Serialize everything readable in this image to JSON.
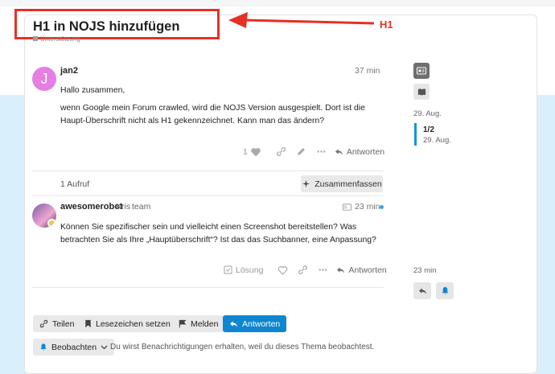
{
  "topic": {
    "title": "H1 in NOJS hinzufügen",
    "category": "Unterstützung"
  },
  "annotation": {
    "label": "H1"
  },
  "posts": [
    {
      "avatar_letter": "J",
      "username": "jan2",
      "time": "37 min",
      "paragraphs": [
        "Hallo zusammen,",
        "wenn Google mein Forum crawled, wird die NOJS Version ausgespielt. Dort ist die Haupt-Überschrift nicht als H1 gekennzeichnet. Kann man das ändern?"
      ],
      "like_count": "1",
      "reply_label": "Antworten"
    },
    {
      "username": "awesomerobot",
      "full_name": "Kris",
      "group": "team",
      "time": "23 min",
      "paragraphs": [
        "Können Sie spezifischer sein und vielleicht einen Screenshot bereitstellen? Was betrachten Sie als Ihre „Hauptüberschrift“? Ist das das Suchbanner, eine Anpassung?"
      ],
      "solution_label": "Lösung",
      "reply_label": "Antworten"
    }
  ],
  "views": {
    "label": "1 Aufruf"
  },
  "summarize_button": "Zusammenfassen",
  "timeline": {
    "start_date": "29. Aug.",
    "position": "1/2",
    "position_date": "29. Aug.",
    "end_date": "23 min"
  },
  "footer": {
    "share": "Teilen",
    "bookmark": "Lesezeichen setzen",
    "flag": "Melden",
    "reply": "Antworten",
    "watching": "Beobachten",
    "notify_reason": "Du wirst Benachrichtigungen erhalten, weil du dieses Thema beobachtest."
  },
  "colors": {
    "accent": "#0e86d1",
    "annotation_red": "#e53124",
    "banner": "#d9effb"
  }
}
